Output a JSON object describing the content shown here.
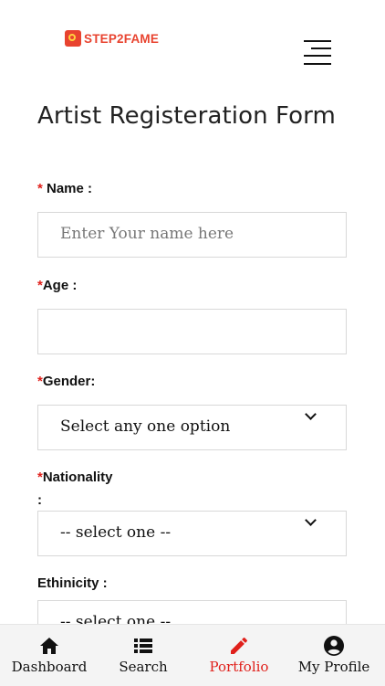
{
  "header": {
    "logo_text": "STEP2FAME",
    "logo_color": "#e8432f"
  },
  "form": {
    "title": "Artist Registeration Form",
    "name": {
      "required_mark": "*",
      "label": " Name :",
      "placeholder": "Enter Your name here"
    },
    "age": {
      "required_mark": "*",
      "label": "Age :",
      "value": ""
    },
    "gender": {
      "required_mark": "*",
      "label": "Gender:",
      "selected": "Select any one option"
    },
    "nationality": {
      "required_mark": "*",
      "label_line1": "Nationality",
      "label_line2": ":",
      "selected": "-- select one --"
    },
    "ethnicity": {
      "label": "Ethinicity :",
      "selected": "-- select one --"
    }
  },
  "nav": {
    "items": [
      {
        "label": "Dashboard",
        "icon": "home-icon"
      },
      {
        "label": "Search",
        "icon": "list-icon"
      },
      {
        "label": "Portfolio",
        "icon": "pencil-icon",
        "active": true
      },
      {
        "label": "My Profile",
        "icon": "user-circle-icon"
      }
    ]
  },
  "colors": {
    "accent": "#e0201b"
  }
}
